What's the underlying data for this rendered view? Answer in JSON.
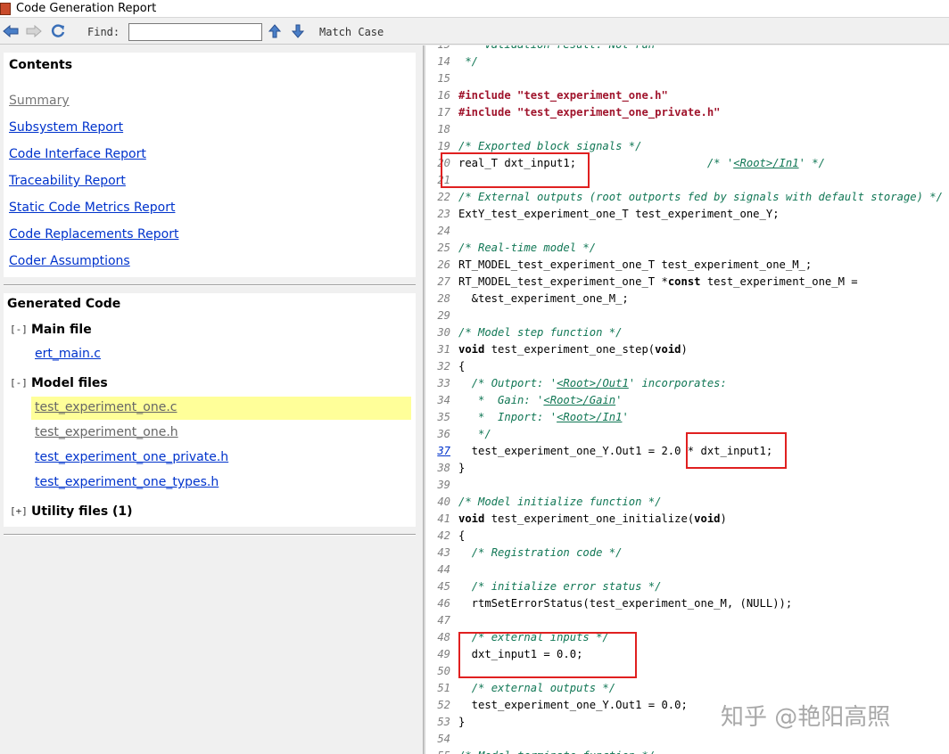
{
  "window": {
    "title": "Code Generation Report"
  },
  "toolbar": {
    "back_icon": "arrow-left-icon",
    "forward_icon": "arrow-right-icon",
    "refresh_icon": "refresh-icon",
    "find_label": "Find:",
    "find_value": "",
    "up_icon": "arrow-up-icon",
    "down_icon": "arrow-down-icon",
    "match_case": "Match Case"
  },
  "contents": {
    "heading": "Contents",
    "links": [
      {
        "label": "Summary",
        "visited": true
      },
      {
        "label": "Subsystem Report"
      },
      {
        "label": "Code Interface Report"
      },
      {
        "label": "Traceability Report"
      },
      {
        "label": "Static Code Metrics Report"
      },
      {
        "label": "Code Replacements Report"
      },
      {
        "label": "Coder Assumptions"
      }
    ]
  },
  "generated": {
    "heading": "Generated Code",
    "main": {
      "toggle": "[-]",
      "label": "Main file",
      "files": [
        "ert_main.c"
      ]
    },
    "model": {
      "toggle": "[-]",
      "label": "Model files",
      "files": [
        "test_experiment_one.c",
        "test_experiment_one.h",
        "test_experiment_one_private.h",
        "test_experiment_one_types.h"
      ],
      "selected": "test_experiment_one.c"
    },
    "utility": {
      "toggle": "[+]",
      "label": "Utility files (1)"
    }
  },
  "code": {
    "lines": [
      {
        "n": "15",
        "html": "  <span class='c'>  Validation result: Not run</span>"
      },
      {
        "n": "14",
        "html": "<span class='c'> */</span>"
      },
      {
        "n": "15",
        "html": ""
      },
      {
        "n": "16",
        "html": "<span class='pp'>#include</span> <span class='str'>\"test_experiment_one.h\"</span>"
      },
      {
        "n": "17",
        "html": "<span class='pp'>#include</span> <span class='str'>\"test_experiment_one_private.h\"</span>"
      },
      {
        "n": "18",
        "html": ""
      },
      {
        "n": "19",
        "html": "<span class='c'>/* Exported block signals */</span>"
      },
      {
        "n": "20",
        "html": "real_T dxt_input1;                    <span class='c'>/* '<span class='lnk'>&lt;Root&gt;/In1</span>' */</span>"
      },
      {
        "n": "21",
        "html": ""
      },
      {
        "n": "22",
        "html": "<span class='c'>/* External outputs (root outports fed by signals with default storage) */</span>"
      },
      {
        "n": "23",
        "html": "ExtY_test_experiment_one_T test_experiment_one_Y;"
      },
      {
        "n": "24",
        "html": ""
      },
      {
        "n": "25",
        "html": "<span class='c'>/* Real-time model */</span>"
      },
      {
        "n": "26",
        "html": "RT_MODEL_test_experiment_one_T test_experiment_one_M_;"
      },
      {
        "n": "27",
        "html": "RT_MODEL_test_experiment_one_T *<span class='kw'>const</span> test_experiment_one_M ="
      },
      {
        "n": "28",
        "html": "  &amp;test_experiment_one_M_;"
      },
      {
        "n": "29",
        "html": ""
      },
      {
        "n": "30",
        "html": "<span class='c'>/* Model step function */</span>"
      },
      {
        "n": "31",
        "html": "<span class='kw'>void</span> test_experiment_one_step(<span class='kw'>void</span>)"
      },
      {
        "n": "32",
        "html": "{"
      },
      {
        "n": "33",
        "html": "  <span class='c'>/* Outport: '<span class='lnk'>&lt;Root&gt;/Out1</span>' incorporates:</span>"
      },
      {
        "n": "34",
        "html": "  <span class='c'> *  Gain: '<span class='lnk'>&lt;Root&gt;/Gain</span>'</span>"
      },
      {
        "n": "35",
        "html": "  <span class='c'> *  Inport: '<span class='lnk'>&lt;Root&gt;/In1</span>'</span>"
      },
      {
        "n": "36",
        "html": "  <span class='c'> */</span>"
      },
      {
        "n": "37",
        "link": true,
        "html": "  test_experiment_one_Y.Out1 = 2.0 * dxt_input1;"
      },
      {
        "n": "38",
        "html": "}"
      },
      {
        "n": "39",
        "html": ""
      },
      {
        "n": "40",
        "html": "<span class='c'>/* Model initialize function */</span>"
      },
      {
        "n": "41",
        "html": "<span class='kw'>void</span> test_experiment_one_initialize(<span class='kw'>void</span>)"
      },
      {
        "n": "42",
        "html": "{"
      },
      {
        "n": "43",
        "html": "  <span class='c'>/* Registration code */</span>"
      },
      {
        "n": "44",
        "html": ""
      },
      {
        "n": "45",
        "html": "  <span class='c'>/* initialize error status */</span>"
      },
      {
        "n": "46",
        "html": "  rtmSetErrorStatus(test_experiment_one_M, (NULL));"
      },
      {
        "n": "47",
        "html": ""
      },
      {
        "n": "48",
        "html": "  <span class='c'>/* external inputs */</span>"
      },
      {
        "n": "49",
        "html": "  dxt_input1 = 0.0;"
      },
      {
        "n": "50",
        "html": ""
      },
      {
        "n": "51",
        "html": "  <span class='c'>/* external outputs */</span>"
      },
      {
        "n": "52",
        "html": "  test_experiment_one_Y.Out1 = 0.0;"
      },
      {
        "n": "53",
        "html": "}"
      },
      {
        "n": "54",
        "html": ""
      },
      {
        "n": "55",
        "html": "<span class='c'>/* Model terminate function */</span>"
      }
    ]
  },
  "watermark": "知乎 @艳阳高照",
  "colors": {
    "highlight": "#e02020",
    "selection": "#ffff99",
    "link": "#0033cc",
    "comment": "#117755"
  }
}
